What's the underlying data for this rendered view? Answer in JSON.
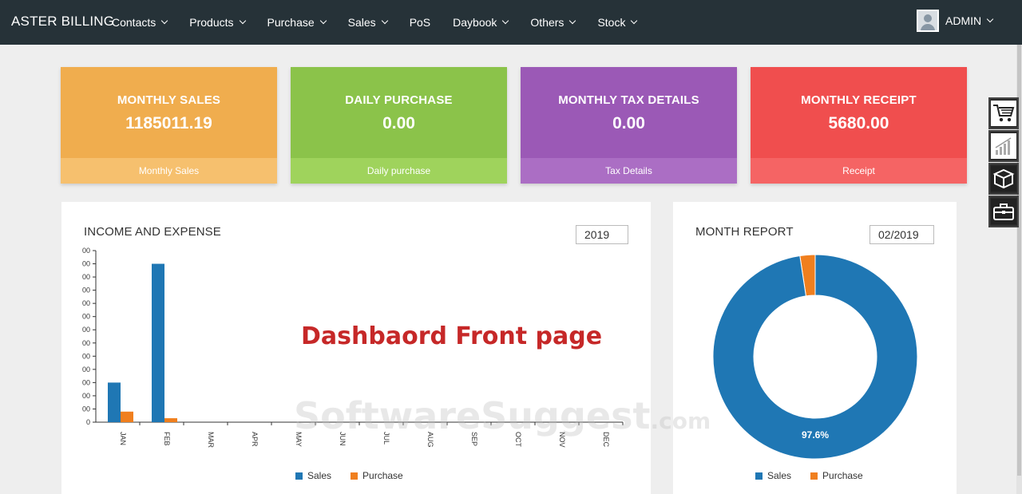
{
  "nav": {
    "brand": "ASTER BILLING",
    "menu": [
      "Contacts",
      "Products",
      "Purchase",
      "Sales",
      "PoS",
      "Daybook",
      "Others",
      "Stock"
    ],
    "menu_has_dropdown": [
      true,
      true,
      true,
      true,
      false,
      true,
      true,
      true
    ],
    "user": "ADMIN"
  },
  "cards": [
    {
      "title": "MONTHLY SALES",
      "value": "1185011.19",
      "footer": "Monthly Sales",
      "color": "#f0ad4e"
    },
    {
      "title": "DAILY PURCHASE",
      "value": "0.00",
      "footer": "Daily purchase",
      "color": "#8bc34a"
    },
    {
      "title": "MONTHLY TAX DETAILS",
      "value": "0.00",
      "footer": "Tax Details",
      "color": "#9b59b6"
    },
    {
      "title": "MONTHLY RECEIPT",
      "value": "5680.00",
      "footer": "Receipt",
      "color": "#f04e4e"
    }
  ],
  "sidebar_tools": [
    "cart-icon",
    "growth-chart-icon",
    "box-icon",
    "briefcase-icon"
  ],
  "income_panel": {
    "title": "INCOME AND EXPENSE",
    "year": "2019"
  },
  "month_panel": {
    "title": "MONTH REPORT",
    "month": "02/2019"
  },
  "legend": {
    "sales": "Sales",
    "purchase": "Purchase"
  },
  "colors": {
    "sales": "#1f77b4",
    "purchase": "#f07f1e"
  },
  "overlay_caption": "Dashbaord Front page",
  "watermark": {
    "main": "SoftwareSuggest",
    "suffix": ".com"
  },
  "chart_data": [
    {
      "type": "bar",
      "title": "INCOME AND EXPENSE",
      "categories": [
        "JAN",
        "FEB",
        "MAR",
        "APR",
        "MAY",
        "JUN",
        "JUL",
        "AUG",
        "SEP",
        "OCT",
        "NOV",
        "DEC"
      ],
      "series": [
        {
          "name": "Sales",
          "values": [
            30,
            120,
            0,
            0,
            0,
            0,
            0,
            0,
            0,
            0,
            0,
            0
          ]
        },
        {
          "name": "Purchase",
          "values": [
            8,
            3,
            0,
            0,
            0,
            0,
            0,
            0,
            0,
            0,
            0,
            0
          ]
        }
      ],
      "ylim": [
        0,
        130
      ],
      "y_tick_labels": [
        "0",
        "00",
        "00",
        "00",
        "00",
        "00",
        "00",
        "00",
        "00",
        "00",
        "00",
        "00",
        "00",
        "00"
      ],
      "legend": "bottom"
    },
    {
      "type": "pie",
      "title": "MONTH REPORT",
      "donut": true,
      "categories": [
        "Sales",
        "Purchase"
      ],
      "values": [
        97.6,
        2.4
      ],
      "data_labels": [
        "97.6%",
        ""
      ],
      "legend": "bottom"
    }
  ]
}
